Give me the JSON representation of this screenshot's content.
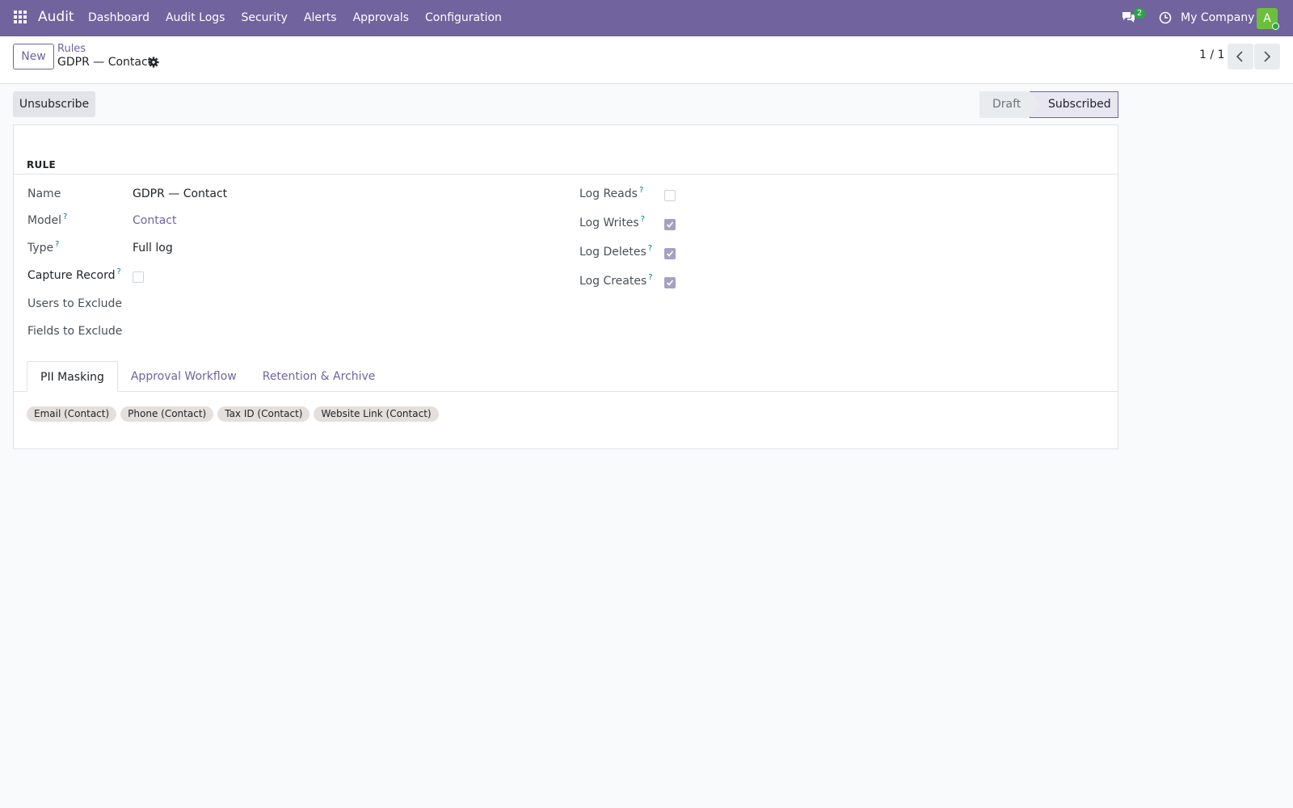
{
  "navbar": {
    "brand": "Audit",
    "menu": [
      "Dashboard",
      "Audit Logs",
      "Security",
      "Alerts",
      "Approvals",
      "Configuration"
    ],
    "chat_count": "2",
    "company": "My Company",
    "avatar_letter": "A",
    "color": "#71639e"
  },
  "control": {
    "new_label": "New",
    "breadcrumb_parent": "Rules",
    "breadcrumb_current": "GDPR — Contact",
    "pager": "1 / 1"
  },
  "status": {
    "unsubscribe_label": "Unsubscribe",
    "stages": [
      "Draft",
      "Subscribed"
    ],
    "active_stage": "Subscribed"
  },
  "form": {
    "group_title": "RULE",
    "name_label": "Name",
    "name_value": "GDPR — Contact",
    "model_label": "Model",
    "model_value": "Contact",
    "type_label": "Type",
    "type_value": "Full log",
    "capture_label": "Capture Record",
    "capture_checked": false,
    "users_exclude_label": "Users to Exclude",
    "fields_exclude_label": "Fields to Exclude",
    "log_reads_label": "Log Reads",
    "log_reads": false,
    "log_writes_label": "Log Writes",
    "log_writes": true,
    "log_deletes_label": "Log Deletes",
    "log_deletes": true,
    "log_creates_label": "Log Creates",
    "log_creates": true,
    "help_mark": "?"
  },
  "tabs": {
    "items": [
      "PII Masking",
      "Approval Workflow",
      "Retention & Archive"
    ],
    "active": "PII Masking"
  },
  "pii_tags": [
    "Email (Contact)",
    "Phone (Contact)",
    "Tax ID (Contact)",
    "Website Link (Contact)"
  ]
}
